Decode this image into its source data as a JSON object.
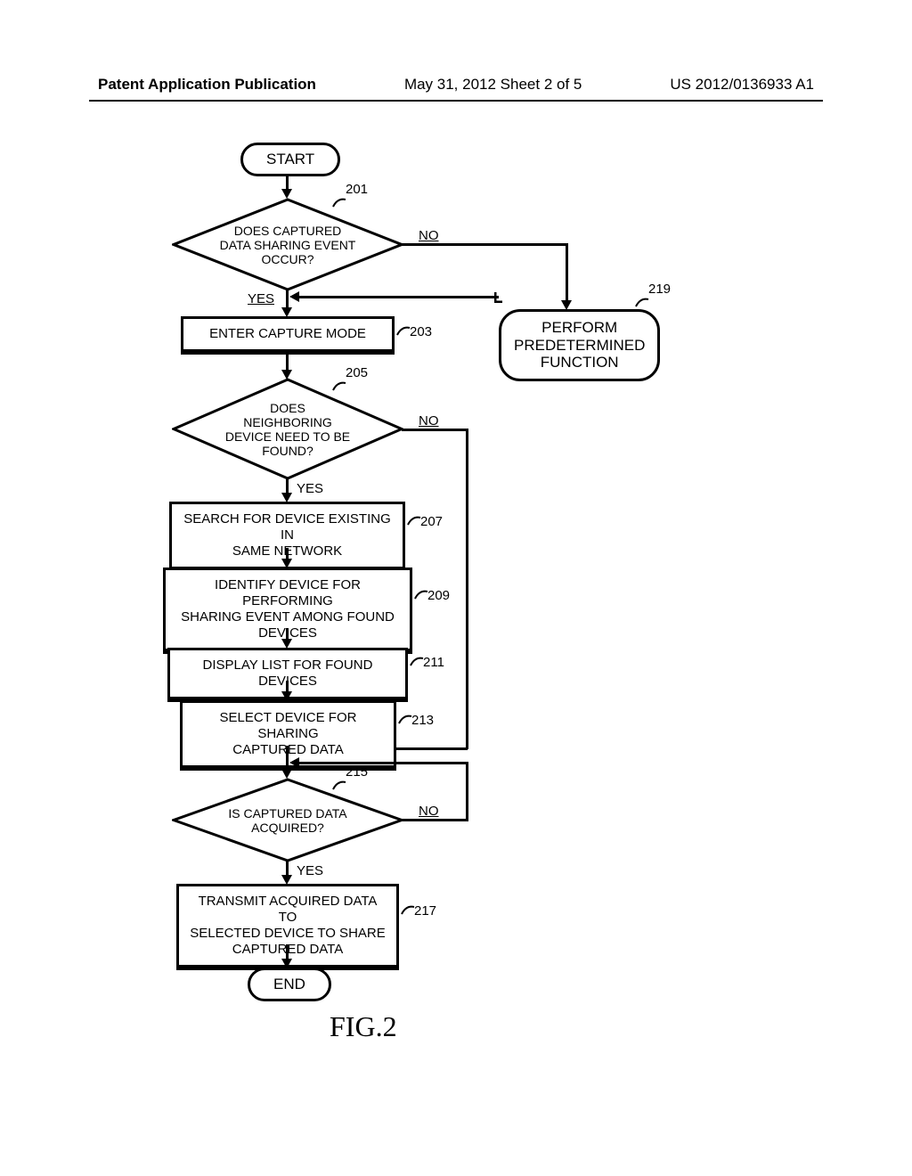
{
  "header": {
    "left": "Patent Application Publication",
    "center": "May 31, 2012   Sheet 2 of 5",
    "right": "US 2012/0136933 A1"
  },
  "flow": {
    "start": "START",
    "end": "END",
    "d201": "DOES CAPTURED\nDATA SHARING EVENT\nOCCUR?",
    "d205": "DOES\nNEIGHBORING\nDEVICE NEED TO BE\nFOUND?",
    "d215": "IS CAPTURED DATA\nACQUIRED?",
    "p203": "ENTER CAPTURE MODE",
    "p207": "SEARCH FOR DEVICE EXISTING IN\nSAME NETWORK",
    "p209": "IDENTIFY DEVICE FOR PERFORMING\nSHARING EVENT AMONG FOUND\nDEVICES",
    "p211": "DISPLAY LIST FOR FOUND DEVICES",
    "p213": "SELECT DEVICE FOR SHARING\nCAPTURED DATA",
    "p217": "TRANSMIT ACQUIRED DATA TO\nSELECTED DEVICE TO SHARE\nCAPTURED DATA",
    "t219": "PERFORM\nPREDETERMINED\nFUNCTION"
  },
  "labels": {
    "yes": "YES",
    "no": "NO"
  },
  "refs": {
    "r201": "201",
    "r203": "203",
    "r205": "205",
    "r207": "207",
    "r209": "209",
    "r211": "211",
    "r213": "213",
    "r215": "215",
    "r217": "217",
    "r219": "219"
  },
  "figure_caption": "FIG.2",
  "chart_data": {
    "type": "flowchart",
    "nodes": [
      {
        "id": "start",
        "kind": "terminal",
        "text": "START"
      },
      {
        "id": "201",
        "kind": "decision",
        "text": "DOES CAPTURED DATA SHARING EVENT OCCUR?"
      },
      {
        "id": "203",
        "kind": "process",
        "text": "ENTER CAPTURE MODE"
      },
      {
        "id": "205",
        "kind": "decision",
        "text": "DOES NEIGHBORING DEVICE NEED TO BE FOUND?"
      },
      {
        "id": "207",
        "kind": "process",
        "text": "SEARCH FOR DEVICE EXISTING IN SAME NETWORK"
      },
      {
        "id": "209",
        "kind": "process",
        "text": "IDENTIFY DEVICE FOR PERFORMING SHARING EVENT AMONG FOUND DEVICES"
      },
      {
        "id": "211",
        "kind": "process",
        "text": "DISPLAY LIST FOR FOUND DEVICES"
      },
      {
        "id": "213",
        "kind": "process",
        "text": "SELECT DEVICE FOR SHARING CAPTURED DATA"
      },
      {
        "id": "215",
        "kind": "decision",
        "text": "IS CAPTURED DATA ACQUIRED?"
      },
      {
        "id": "217",
        "kind": "process",
        "text": "TRANSMIT ACQUIRED DATA TO SELECTED DEVICE TO SHARE CAPTURED DATA"
      },
      {
        "id": "219",
        "kind": "terminal",
        "text": "PERFORM PREDETERMINED FUNCTION"
      },
      {
        "id": "end",
        "kind": "terminal",
        "text": "END"
      }
    ],
    "edges": [
      {
        "from": "start",
        "to": "201"
      },
      {
        "from": "201",
        "to": "203",
        "label": "YES"
      },
      {
        "from": "201",
        "to": "219",
        "label": "NO"
      },
      {
        "from": "219",
        "to": "203"
      },
      {
        "from": "203",
        "to": "205"
      },
      {
        "from": "205",
        "to": "207",
        "label": "YES"
      },
      {
        "from": "205",
        "to": "213",
        "label": "NO"
      },
      {
        "from": "207",
        "to": "209"
      },
      {
        "from": "209",
        "to": "211"
      },
      {
        "from": "211",
        "to": "213"
      },
      {
        "from": "213",
        "to": "215"
      },
      {
        "from": "215",
        "to": "217",
        "label": "YES"
      },
      {
        "from": "215",
        "to": "215",
        "label": "NO"
      },
      {
        "from": "217",
        "to": "end"
      }
    ]
  }
}
